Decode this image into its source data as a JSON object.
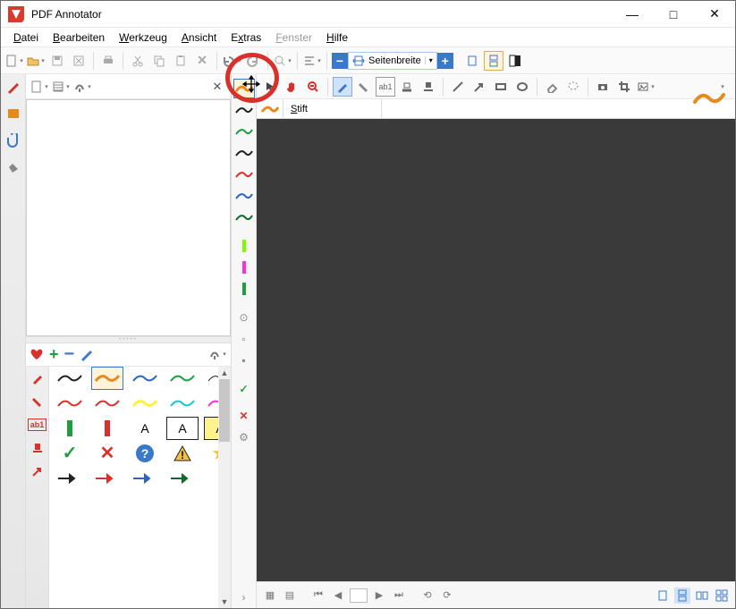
{
  "window": {
    "title": "PDF Annotator"
  },
  "menu": {
    "datei": {
      "label": "Datei",
      "key": "D"
    },
    "bearbeiten": {
      "label": "Bearbeiten",
      "key": "B"
    },
    "werkzeug": {
      "label": "Werkzeug",
      "key": "W"
    },
    "ansicht": {
      "label": "Ansicht",
      "key": "A"
    },
    "extras": {
      "label": "Extras",
      "key": "E"
    },
    "fenster": {
      "label": "Fenster",
      "key": "F",
      "disabled": true
    },
    "hilfe": {
      "label": "Hilfe",
      "key": "H"
    }
  },
  "zoom": {
    "value": "Seitenbreite"
  },
  "tool": {
    "current_label": "Stift"
  },
  "colors": {
    "red": "#d9302b",
    "orange": "#e78a1e",
    "blue": "#2c63c4",
    "green": "#1e9e3e",
    "darkgreen": "#0b6b2b",
    "black": "#222222",
    "lime": "#7cfc00",
    "magenta": "#ff2fd6",
    "cyan": "#16c8c8",
    "yellow": "#fff23a",
    "grey": "#888888"
  },
  "favorites": {
    "letter": "A"
  },
  "icons": {
    "minimize": "—",
    "maximize": "□",
    "close": "✕",
    "plus": "+",
    "minus": "−",
    "check": "✓",
    "cross": "✕",
    "question": "?",
    "warning": "!",
    "star": "★"
  }
}
